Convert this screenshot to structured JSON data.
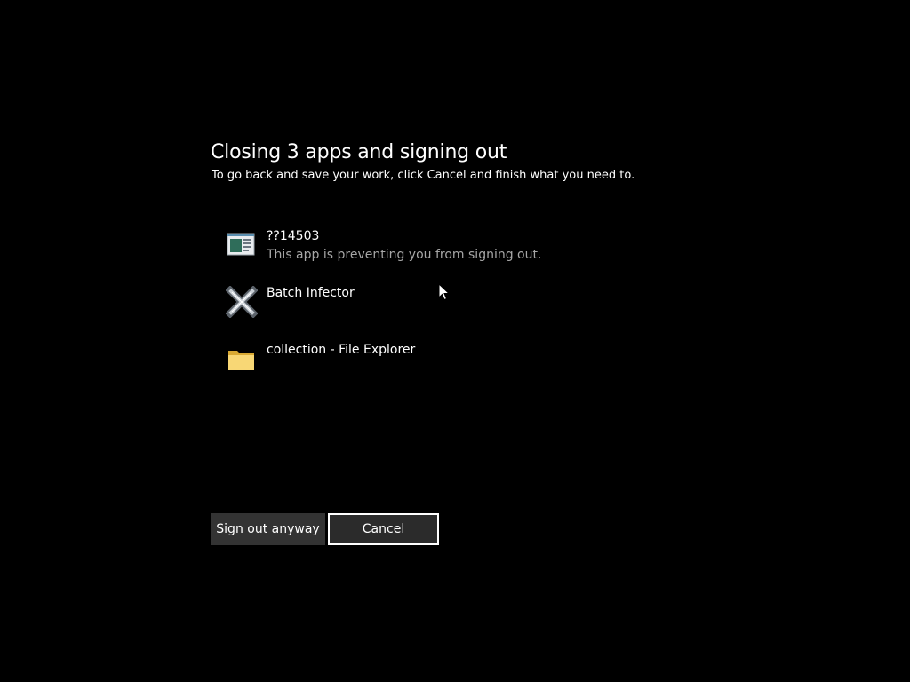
{
  "dialog": {
    "title": "Closing 3 apps and signing out",
    "subtitle": "To go back and save your work, click Cancel and finish what you need to."
  },
  "apps": [
    {
      "name": "??14503",
      "status": "This app is preventing you from signing out.",
      "icon": "app-window-icon"
    },
    {
      "name": "Batch Infector",
      "status": "",
      "icon": "batch-infector-icon"
    },
    {
      "name": "collection - File Explorer",
      "status": "",
      "icon": "folder-icon"
    }
  ],
  "buttons": {
    "sign_out_anyway": "Sign out anyway",
    "cancel": "Cancel"
  },
  "colors": {
    "background": "#000000",
    "text": "#ffffff",
    "status_text": "#a6a6a6",
    "button_bg": "#333333",
    "folder": "#f8d775"
  }
}
